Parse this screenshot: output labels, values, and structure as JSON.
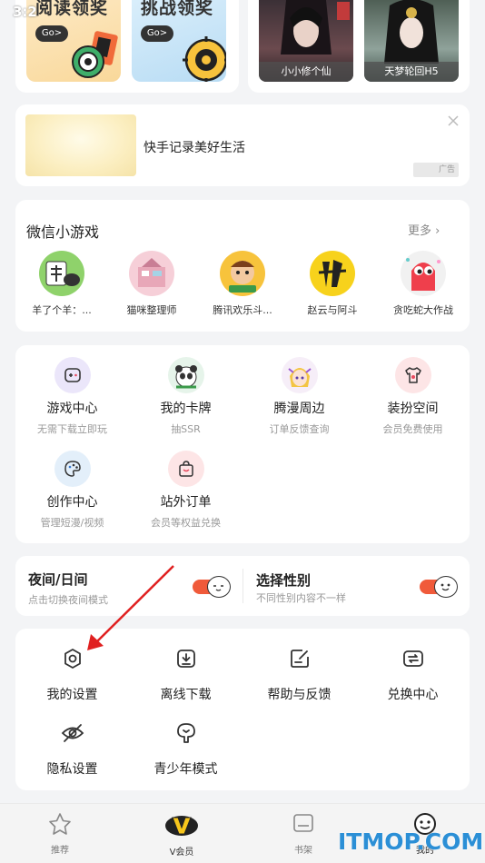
{
  "status": {
    "time": "3:2"
  },
  "promos": [
    {
      "title": "阅读领奖",
      "go": "Go>"
    },
    {
      "title": "挑战领奖",
      "go": "Go>"
    }
  ],
  "covers": [
    {
      "caption": "小小修个仙"
    },
    {
      "caption": "天梦轮回H5"
    }
  ],
  "ad": {
    "text": "快手记录美好生活",
    "badge": "广告"
  },
  "mini_games": {
    "title": "微信小游戏",
    "more": "更多",
    "items": [
      {
        "label": "羊了个羊：..."
      },
      {
        "label": "猫咪整理师"
      },
      {
        "label": "腾讯欢乐斗..."
      },
      {
        "label": "赵云与阿斗"
      },
      {
        "label": "贪吃蛇大作战"
      }
    ]
  },
  "tools": [
    {
      "title": "游戏中心",
      "sub": "无需下载立即玩"
    },
    {
      "title": "我的卡牌",
      "sub": "抽SSR"
    },
    {
      "title": "腾漫周边",
      "sub": "订单反馈查询"
    },
    {
      "title": "装扮空间",
      "sub": "会员免费使用"
    },
    {
      "title": "创作中心",
      "sub": "管理短漫/视频"
    },
    {
      "title": "站外订单",
      "sub": "会员等权益兑换"
    }
  ],
  "night_mode": {
    "title": "夜间/日间",
    "sub": "点击切换夜间模式"
  },
  "gender": {
    "title": "选择性别",
    "sub": "不同性别内容不一样"
  },
  "settings": [
    {
      "label": "我的设置"
    },
    {
      "label": "离线下载"
    },
    {
      "label": "帮助与反馈"
    },
    {
      "label": "兑换中心"
    },
    {
      "label": "隐私设置"
    },
    {
      "label": "青少年模式"
    }
  ],
  "tabs": [
    {
      "label": "推荐"
    },
    {
      "label": "V会员"
    },
    {
      "label": "书架"
    },
    {
      "label": "我的"
    }
  ],
  "watermark": "ITMOP.COM",
  "colors": {
    "accent": "#f05a3a",
    "background": "#f3f4f6"
  }
}
